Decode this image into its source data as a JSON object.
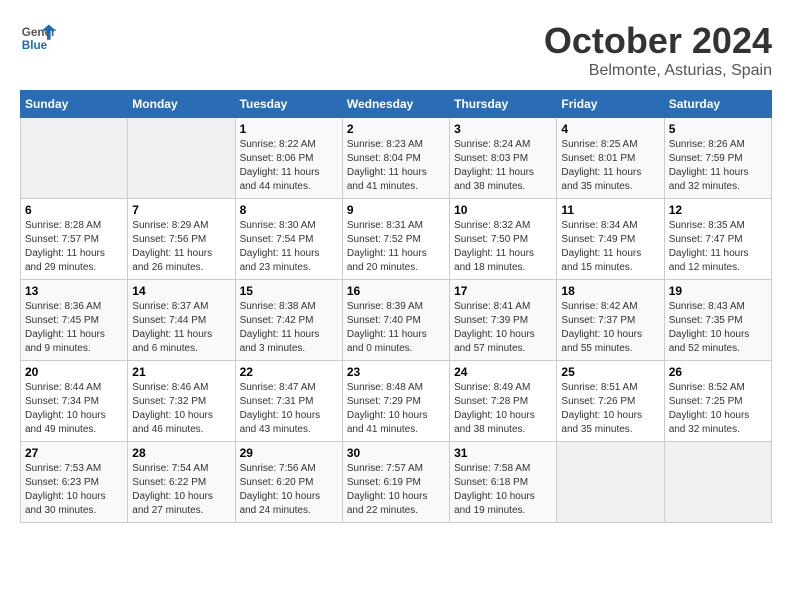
{
  "header": {
    "logo_general": "General",
    "logo_blue": "Blue",
    "month": "October 2024",
    "location": "Belmonte, Asturias, Spain"
  },
  "days_of_week": [
    "Sunday",
    "Monday",
    "Tuesday",
    "Wednesday",
    "Thursday",
    "Friday",
    "Saturday"
  ],
  "weeks": [
    [
      {
        "day": "",
        "info": ""
      },
      {
        "day": "",
        "info": ""
      },
      {
        "day": "1",
        "info": "Sunrise: 8:22 AM\nSunset: 8:06 PM\nDaylight: 11 hours and 44 minutes."
      },
      {
        "day": "2",
        "info": "Sunrise: 8:23 AM\nSunset: 8:04 PM\nDaylight: 11 hours and 41 minutes."
      },
      {
        "day": "3",
        "info": "Sunrise: 8:24 AM\nSunset: 8:03 PM\nDaylight: 11 hours and 38 minutes."
      },
      {
        "day": "4",
        "info": "Sunrise: 8:25 AM\nSunset: 8:01 PM\nDaylight: 11 hours and 35 minutes."
      },
      {
        "day": "5",
        "info": "Sunrise: 8:26 AM\nSunset: 7:59 PM\nDaylight: 11 hours and 32 minutes."
      }
    ],
    [
      {
        "day": "6",
        "info": "Sunrise: 8:28 AM\nSunset: 7:57 PM\nDaylight: 11 hours and 29 minutes."
      },
      {
        "day": "7",
        "info": "Sunrise: 8:29 AM\nSunset: 7:56 PM\nDaylight: 11 hours and 26 minutes."
      },
      {
        "day": "8",
        "info": "Sunrise: 8:30 AM\nSunset: 7:54 PM\nDaylight: 11 hours and 23 minutes."
      },
      {
        "day": "9",
        "info": "Sunrise: 8:31 AM\nSunset: 7:52 PM\nDaylight: 11 hours and 20 minutes."
      },
      {
        "day": "10",
        "info": "Sunrise: 8:32 AM\nSunset: 7:50 PM\nDaylight: 11 hours and 18 minutes."
      },
      {
        "day": "11",
        "info": "Sunrise: 8:34 AM\nSunset: 7:49 PM\nDaylight: 11 hours and 15 minutes."
      },
      {
        "day": "12",
        "info": "Sunrise: 8:35 AM\nSunset: 7:47 PM\nDaylight: 11 hours and 12 minutes."
      }
    ],
    [
      {
        "day": "13",
        "info": "Sunrise: 8:36 AM\nSunset: 7:45 PM\nDaylight: 11 hours and 9 minutes."
      },
      {
        "day": "14",
        "info": "Sunrise: 8:37 AM\nSunset: 7:44 PM\nDaylight: 11 hours and 6 minutes."
      },
      {
        "day": "15",
        "info": "Sunrise: 8:38 AM\nSunset: 7:42 PM\nDaylight: 11 hours and 3 minutes."
      },
      {
        "day": "16",
        "info": "Sunrise: 8:39 AM\nSunset: 7:40 PM\nDaylight: 11 hours and 0 minutes."
      },
      {
        "day": "17",
        "info": "Sunrise: 8:41 AM\nSunset: 7:39 PM\nDaylight: 10 hours and 57 minutes."
      },
      {
        "day": "18",
        "info": "Sunrise: 8:42 AM\nSunset: 7:37 PM\nDaylight: 10 hours and 55 minutes."
      },
      {
        "day": "19",
        "info": "Sunrise: 8:43 AM\nSunset: 7:35 PM\nDaylight: 10 hours and 52 minutes."
      }
    ],
    [
      {
        "day": "20",
        "info": "Sunrise: 8:44 AM\nSunset: 7:34 PM\nDaylight: 10 hours and 49 minutes."
      },
      {
        "day": "21",
        "info": "Sunrise: 8:46 AM\nSunset: 7:32 PM\nDaylight: 10 hours and 46 minutes."
      },
      {
        "day": "22",
        "info": "Sunrise: 8:47 AM\nSunset: 7:31 PM\nDaylight: 10 hours and 43 minutes."
      },
      {
        "day": "23",
        "info": "Sunrise: 8:48 AM\nSunset: 7:29 PM\nDaylight: 10 hours and 41 minutes."
      },
      {
        "day": "24",
        "info": "Sunrise: 8:49 AM\nSunset: 7:28 PM\nDaylight: 10 hours and 38 minutes."
      },
      {
        "day": "25",
        "info": "Sunrise: 8:51 AM\nSunset: 7:26 PM\nDaylight: 10 hours and 35 minutes."
      },
      {
        "day": "26",
        "info": "Sunrise: 8:52 AM\nSunset: 7:25 PM\nDaylight: 10 hours and 32 minutes."
      }
    ],
    [
      {
        "day": "27",
        "info": "Sunrise: 7:53 AM\nSunset: 6:23 PM\nDaylight: 10 hours and 30 minutes."
      },
      {
        "day": "28",
        "info": "Sunrise: 7:54 AM\nSunset: 6:22 PM\nDaylight: 10 hours and 27 minutes."
      },
      {
        "day": "29",
        "info": "Sunrise: 7:56 AM\nSunset: 6:20 PM\nDaylight: 10 hours and 24 minutes."
      },
      {
        "day": "30",
        "info": "Sunrise: 7:57 AM\nSunset: 6:19 PM\nDaylight: 10 hours and 22 minutes."
      },
      {
        "day": "31",
        "info": "Sunrise: 7:58 AM\nSunset: 6:18 PM\nDaylight: 10 hours and 19 minutes."
      },
      {
        "day": "",
        "info": ""
      },
      {
        "day": "",
        "info": ""
      }
    ]
  ]
}
